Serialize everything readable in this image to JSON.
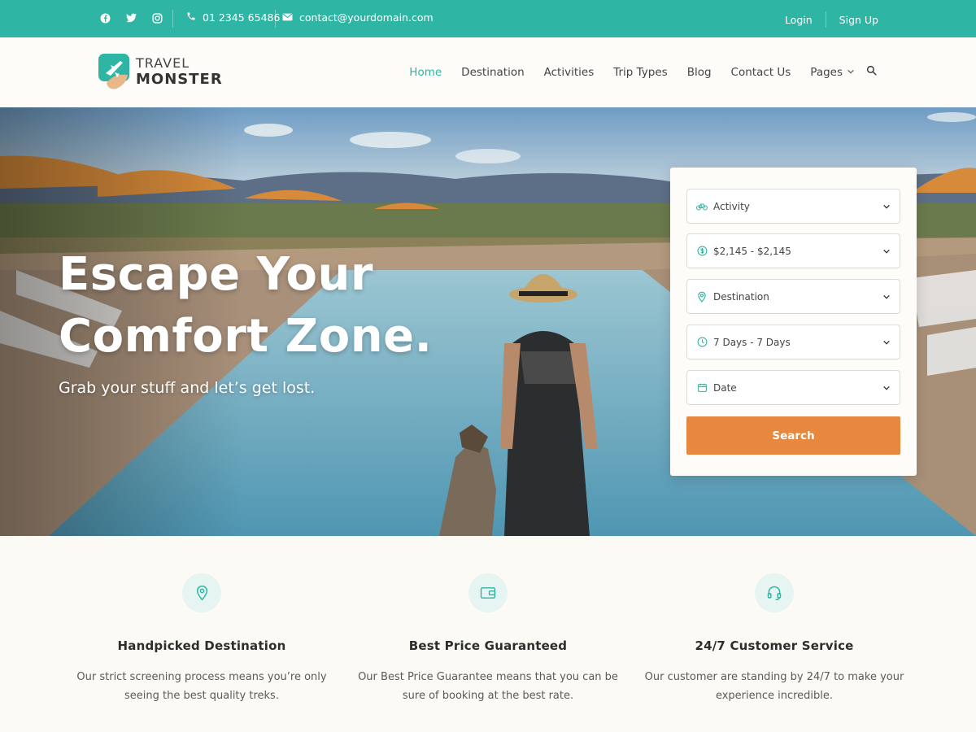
{
  "topbar": {
    "phone": "01 2345 65486",
    "email": "contact@yourdomain.com",
    "login": "Login",
    "signup": "Sign Up",
    "social_icons": [
      "facebook-icon",
      "twitter-icon",
      "instagram-icon"
    ]
  },
  "logo": {
    "line1": "TRAVEL",
    "line2": "MONSTER"
  },
  "nav": {
    "items": [
      "Home",
      "Destination",
      "Activities",
      "Trip Types",
      "Blog",
      "Contact Us"
    ],
    "pages": "Pages",
    "active": "Home"
  },
  "hero": {
    "title_line1": "Escape Your",
    "title_line2": "Comfort Zone.",
    "subtitle": "Grab your stuff and let’s get lost."
  },
  "search": {
    "fields": [
      {
        "icon": "bicycle-icon",
        "label": "Activity"
      },
      {
        "icon": "dollar-icon",
        "label": "$2,145 - $2,145"
      },
      {
        "icon": "location-pin-icon",
        "label": "Destination"
      },
      {
        "icon": "clock-icon",
        "label": "7 Days - 7 Days"
      },
      {
        "icon": "calendar-icon",
        "label": "Date"
      }
    ],
    "button": "Search"
  },
  "features": [
    {
      "icon": "location-pin-icon",
      "title": "Handpicked Destination",
      "desc_line1": "Our strict screening process means you’re only",
      "desc_line2": "seeing the best quality treks."
    },
    {
      "icon": "wallet-icon",
      "title": "Best Price Guaranteed",
      "desc_line1": "Our Best Price Guarantee means that you can be",
      "desc_line2": "sure of booking at the best rate."
    },
    {
      "icon": "headset-icon",
      "title": "24/7 Customer Service",
      "desc_line1": "Our customer are standing by 24/7 to make your",
      "desc_line2": "experience incredible."
    }
  ],
  "colors": {
    "accent": "#2fb5a3",
    "button": "#e8883f",
    "background": "#fdfcf8"
  }
}
